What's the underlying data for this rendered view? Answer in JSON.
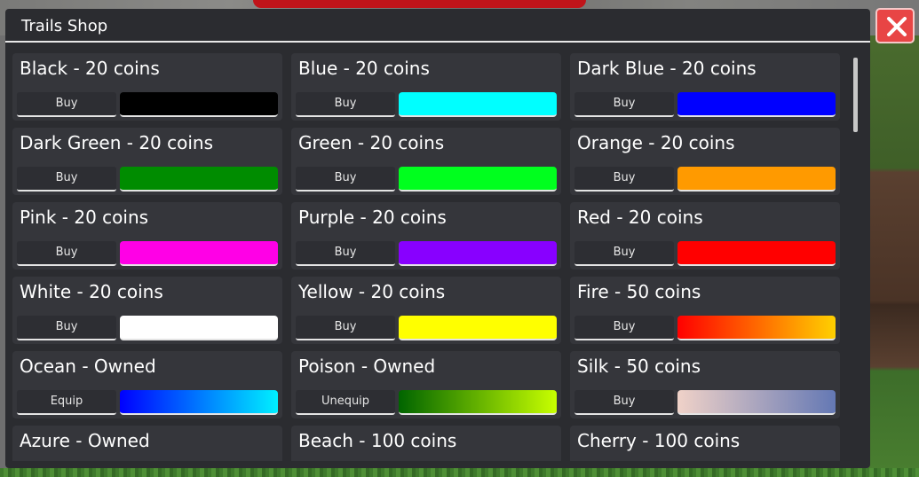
{
  "window": {
    "title": "Trails Shop"
  },
  "trails": [
    {
      "label": "Black - 20 coins",
      "button": "Buy",
      "color": "#000000"
    },
    {
      "label": "Blue - 20 coins",
      "button": "Buy",
      "color": "#00ffff"
    },
    {
      "label": "Dark Blue - 20 coins",
      "button": "Buy",
      "color": "#0000ff"
    },
    {
      "label": "Dark Green - 20 coins",
      "button": "Buy",
      "color": "#008c00"
    },
    {
      "label": "Green - 20 coins",
      "button": "Buy",
      "color": "#00ff1e"
    },
    {
      "label": "Orange - 20 coins",
      "button": "Buy",
      "color": "#ff9a00"
    },
    {
      "label": "Pink - 20 coins",
      "button": "Buy",
      "color": "#ff00e6"
    },
    {
      "label": "Purple - 20 coins",
      "button": "Buy",
      "color": "#8800ff"
    },
    {
      "label": "Red - 20 coins",
      "button": "Buy",
      "color": "#ff0000"
    },
    {
      "label": "White - 20 coins",
      "button": "Buy",
      "color": "#ffffff"
    },
    {
      "label": "Yellow - 20 coins",
      "button": "Buy",
      "color": "#ffff00"
    },
    {
      "label": "Fire - 50 coins",
      "button": "Buy",
      "gradient": [
        "#ff0000",
        "#ffd000"
      ]
    },
    {
      "label": "Ocean - Owned",
      "button": "Equip",
      "gradient": [
        "#0000ff",
        "#00f0ff"
      ]
    },
    {
      "label": "Poison - Owned",
      "button": "Unequip",
      "gradient": [
        "#006400",
        "#c8ff00"
      ]
    },
    {
      "label": "Silk - 50 coins",
      "button": "Buy",
      "gradient": [
        "#f0d2c8",
        "#6478b4"
      ]
    },
    {
      "label": "Azure - Owned",
      "button": "",
      "color": ""
    },
    {
      "label": "Beach - 100 coins",
      "button": "",
      "color": ""
    },
    {
      "label": "Cherry - 100 coins",
      "button": "",
      "color": ""
    }
  ],
  "colors": {
    "panel": "#2b2c30",
    "card": "#35363b",
    "close": "#e84545"
  }
}
